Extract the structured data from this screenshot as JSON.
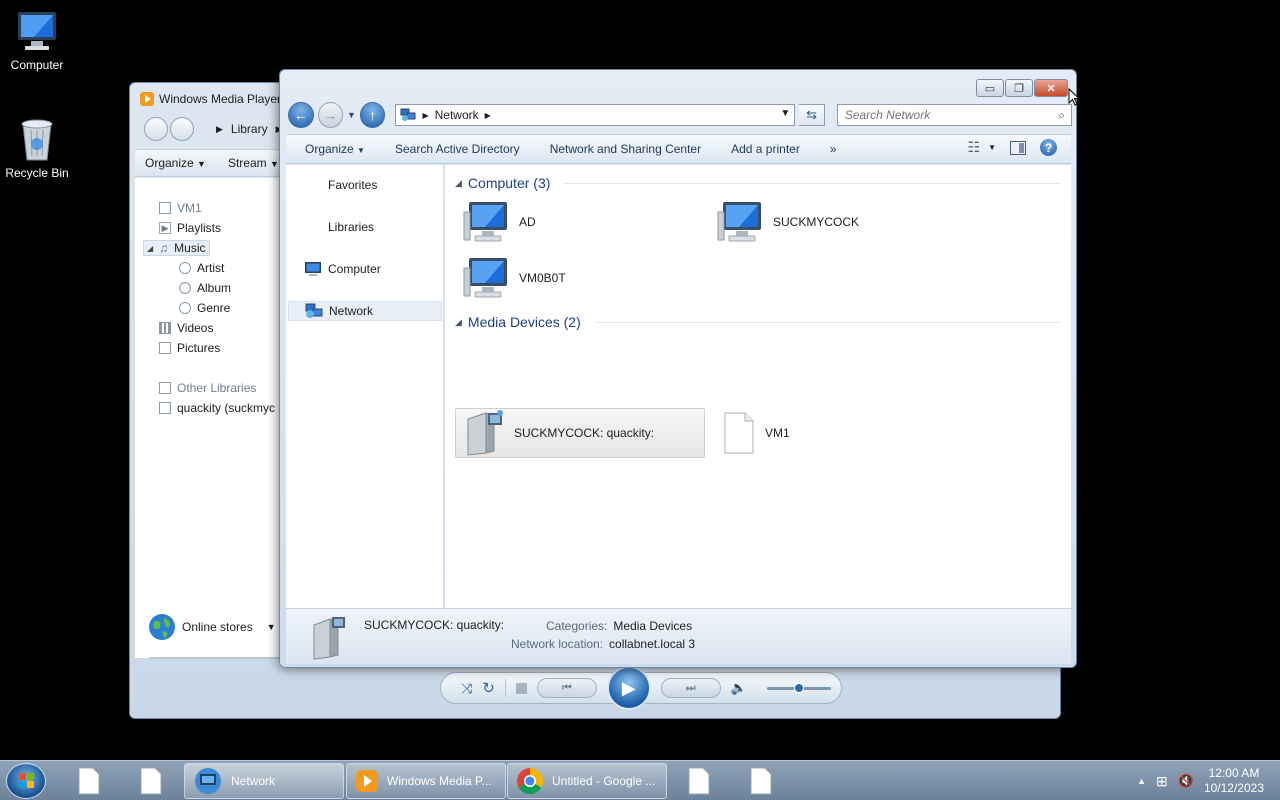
{
  "desktop": {
    "icons": [
      {
        "label": "Computer"
      },
      {
        "label": "Recycle Bin"
      }
    ]
  },
  "wmp": {
    "title": "Windows Media Player",
    "breadcrumb": "Library",
    "toolbar": {
      "organize": "Organize",
      "stream": "Stream"
    },
    "nav": [
      {
        "label": "VM1",
        "dim": true
      },
      {
        "label": "Playlists"
      },
      {
        "label": "Music",
        "selected": true
      },
      {
        "label": "Artist"
      },
      {
        "label": "Album"
      },
      {
        "label": "Genre"
      },
      {
        "label": "Videos"
      },
      {
        "label": "Pictures"
      },
      {
        "label": "Other Libraries",
        "dim": true
      },
      {
        "label": "quackity (suckmyc"
      }
    ],
    "online_stores": "Online stores",
    "volume_level": 0.5
  },
  "explorer": {
    "address": {
      "root": "Network"
    },
    "search": {
      "placeholder": "Search Network"
    },
    "commands": {
      "organize": "Organize",
      "search_ad": "Search Active Directory",
      "sharing_center": "Network and Sharing Center",
      "add_printer": "Add a printer",
      "more": "»"
    },
    "nav_pane": {
      "favorites": "Favorites",
      "libraries": "Libraries",
      "computer": "Computer",
      "network": "Network"
    },
    "groups": {
      "computer": {
        "header": "Computer (3)",
        "items": [
          "AD",
          "SUCKMYCOCK",
          "VM0B0T"
        ]
      },
      "media": {
        "header": "Media Devices (2)",
        "items": [
          "SUCKMYCOCK: quackity:",
          "VM1"
        ]
      }
    },
    "details": {
      "name": "SUCKMYCOCK: quackity:",
      "categories_label": "Categories:",
      "categories_value": "Media Devices",
      "location_label": "Network location:",
      "location_value": "collabnet.local 3"
    }
  },
  "taskbar": {
    "tasks": [
      {
        "label": "Network"
      },
      {
        "label": "Windows Media P..."
      },
      {
        "label": "Untitled - Google ..."
      }
    ],
    "clock": {
      "time": "12:00 AM",
      "date": "10/12/2023"
    }
  },
  "colors": {
    "accent": "#1e3f8a",
    "close_button": "#c74a2d",
    "taskbar": "#7b90a7"
  }
}
